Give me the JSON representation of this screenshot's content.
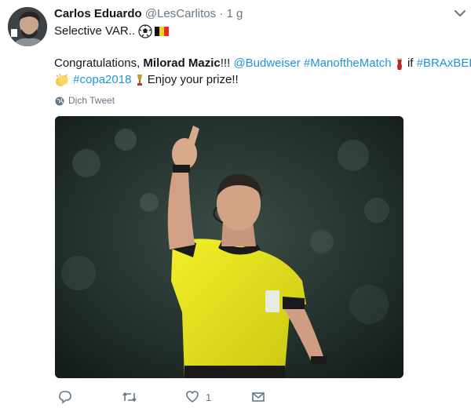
{
  "tweet": {
    "display_name": "Carlos Eduardo",
    "handle": "@LesCarlitos",
    "sep": " · ",
    "time": "1 g",
    "line1_text": "Selective VAR.. ",
    "line2": {
      "t1": "Congratulations, ",
      "name": "Milorad Mazic",
      "t2": "!!! ",
      "mention": "@Budweiser",
      "hashtag1": "#ManoftheMatch",
      "t3": "if ",
      "hashtag2": "#BRAxBEL"
    },
    "line3": {
      "hashtag3": "#copa2018",
      "t4": "Enjoy your prize!!"
    },
    "translate_label": "Dịch Tweet",
    "reply_count": "",
    "retweet_count": "",
    "like_count": "1",
    "dm_count": ""
  },
  "icons": {
    "soccer_ball": "soccer-ball-icon",
    "belgium_flag": "belgium-flag-icon",
    "beer": "beer-glass-icon",
    "clapping": "clapping-hands-icon",
    "trophy": "trophy-icon",
    "globe": "globe-icon"
  },
  "colors": {
    "link": "#1b95e0",
    "muted": "#657786",
    "jersey": "#e8e61c"
  }
}
